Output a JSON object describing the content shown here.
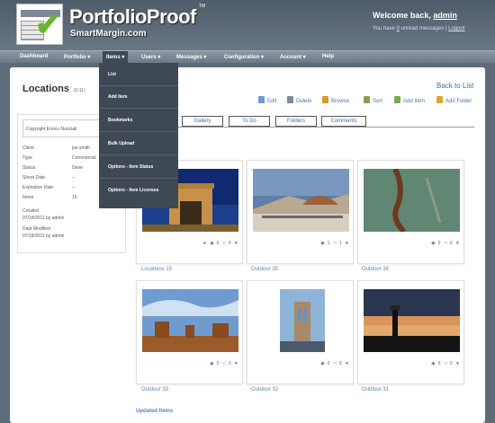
{
  "brand": {
    "name": "PortfolioProof",
    "tm": "TM",
    "sub": "SmartMargin.com"
  },
  "user": {
    "welcome_prefix": "Welcome back, ",
    "name": "admin",
    "msg_prefix": "You have ",
    "unread": "0",
    "msg_suffix": " unread messages",
    "sep": " | ",
    "logout": "Logout"
  },
  "nav": [
    "Dashboard",
    "Portfolio ▾",
    "Items ▾",
    "Users ▾",
    "Messages ▾",
    "Configuration ▾",
    "Account ▾",
    "Help"
  ],
  "dropdown": [
    "List",
    "Add Item",
    "Bookmarks",
    "Bulk Upload",
    "Options - Item Status",
    "Options - Item Licenses"
  ],
  "page": {
    "title": "Locations",
    "count": "(0:11)",
    "back": "Back to List"
  },
  "toolbar": [
    "Edit",
    "Delete",
    "Browse",
    "Sort",
    "Add Item",
    "Add Folder"
  ],
  "toolbar_colors": [
    "#6a9ad0",
    "#7c8aa0",
    "#d69a30",
    "#8aa050",
    "#7aaa4c",
    "#d8a830"
  ],
  "side": {
    "copyright": "Copyright Enrico Nunziati",
    "fields": [
      {
        "label": "Client",
        "value": "joe smith"
      },
      {
        "label": "Type",
        "value": "Commercial"
      },
      {
        "label": "Status",
        "value": "Done"
      },
      {
        "label": "Shoot Date",
        "value": "--"
      },
      {
        "label": "Expiration Date",
        "value": "--"
      },
      {
        "label": "Items",
        "value": "15"
      }
    ],
    "created_label": "Created",
    "created_value": "07/18/2011 by admin",
    "modified_label": "Date Modified",
    "modified_value": "07/18/2011 by admin"
  },
  "tabs": [
    "Gallery",
    "To Do",
    "Folders",
    "Comments"
  ],
  "cards": [
    {
      "label": "Locations 15",
      "views": "0",
      "comments": "0"
    },
    {
      "label": "Outdoor 35",
      "views": "1",
      "comments": "1"
    },
    {
      "label": "Outdoor 34",
      "views": "0",
      "comments": "0"
    },
    {
      "label": "Outdoor 33",
      "views": "0",
      "comments": "0"
    },
    {
      "label": "Outdoor 32",
      "views": "0",
      "comments": "0"
    },
    {
      "label": "Outdoor 31",
      "views": "0",
      "comments": "0"
    }
  ],
  "updated": "Updated Items",
  "icons": {
    "view": "eye-icon",
    "comment": "comment-icon",
    "like": "heart-icon",
    "pin": "pin-icon"
  }
}
